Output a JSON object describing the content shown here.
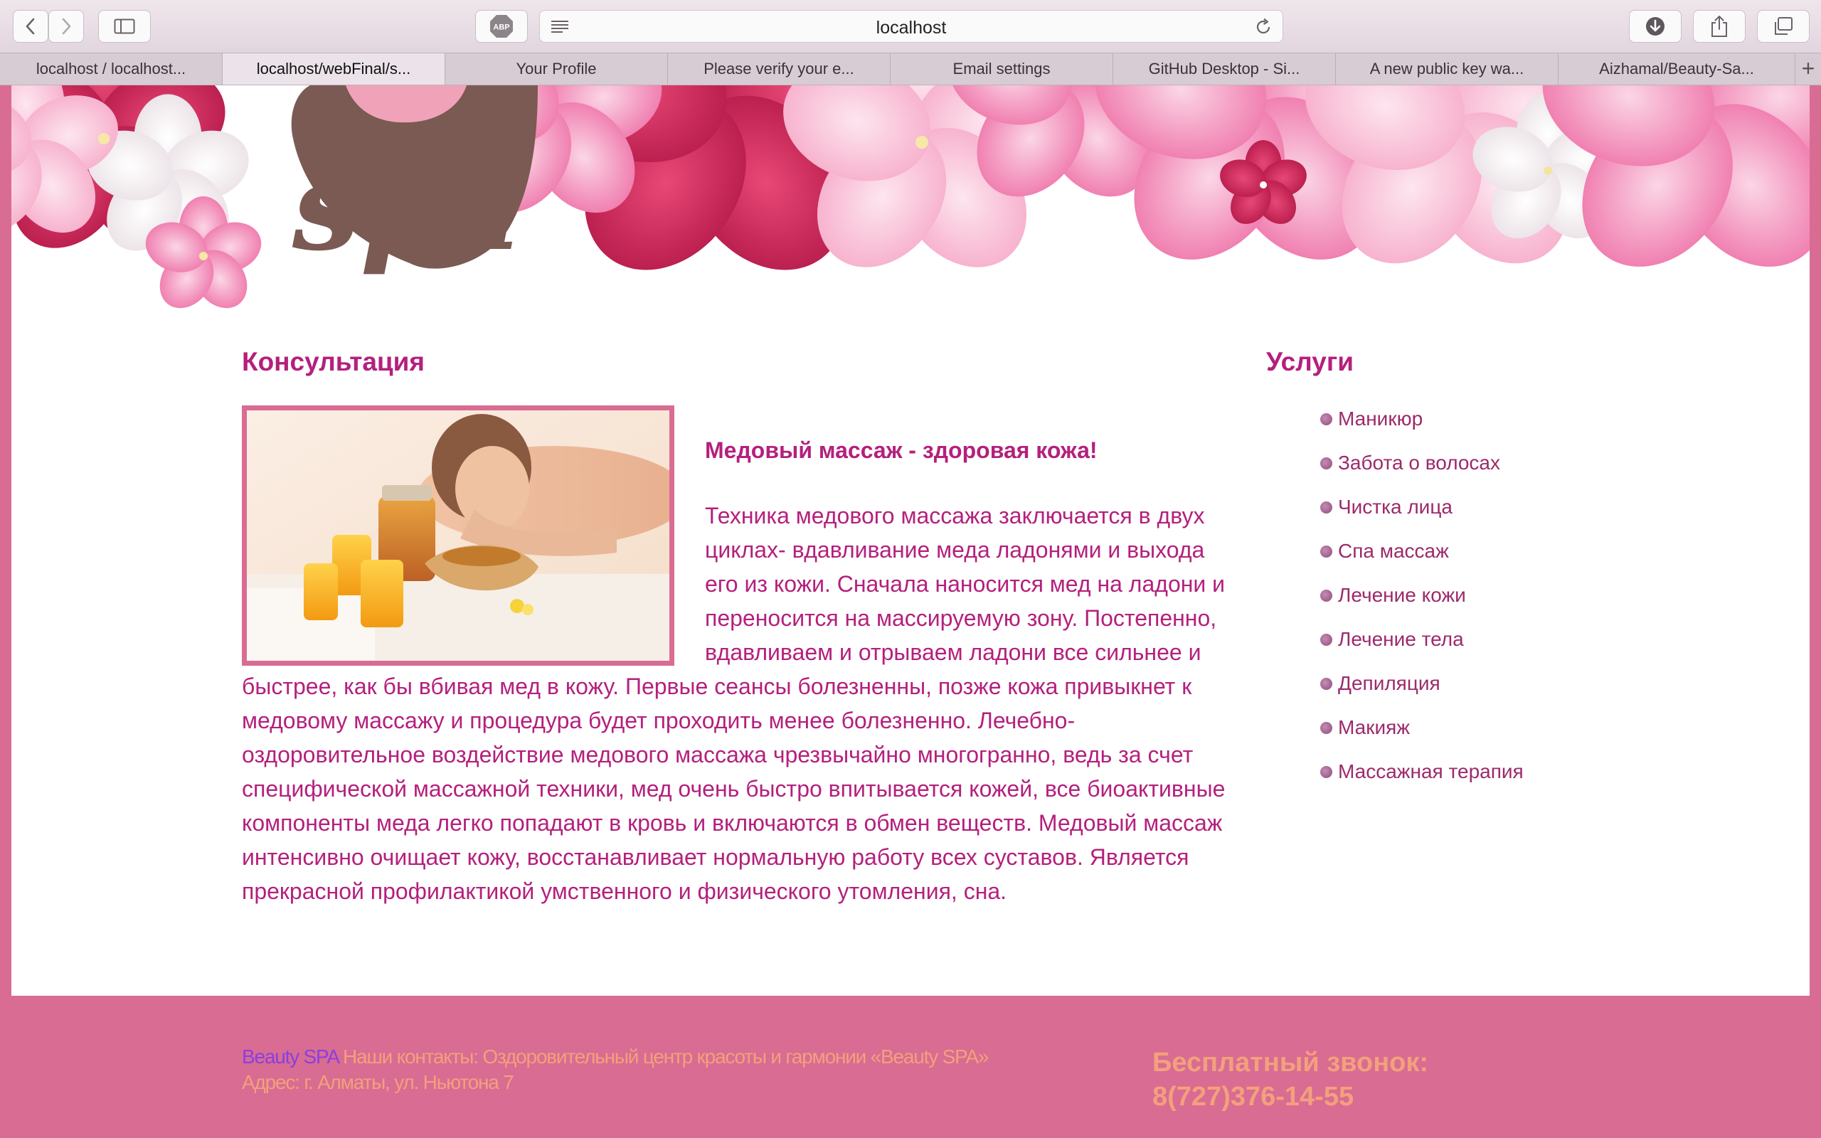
{
  "browser": {
    "url": "localhost",
    "tabs": [
      {
        "title": "localhost / localhost..."
      },
      {
        "title": "localhost/webFinal/s..."
      },
      {
        "title": "Your Profile"
      },
      {
        "title": "Please verify your e..."
      },
      {
        "title": "Email settings"
      },
      {
        "title": "GitHub Desktop - Si..."
      },
      {
        "title": "A new public key wa..."
      },
      {
        "title": "Aizhamal/Beauty-Sa..."
      }
    ],
    "active_tab": 1,
    "new_tab_label": "+",
    "adblock_label": "ABP"
  },
  "header": {
    "logo_text": "spa"
  },
  "main": {
    "title": "Консультация",
    "article_heading": "Медовый массаж - здоровая кожа!",
    "paragraph_lines": [
      "Техника медового массажа заключается в двух",
      "циклах- вдавливание меда ладонями и выхода",
      "его из кожи. Сначала наносится мед на ладони и",
      "переносится на массируемую зону. Постепенно,",
      "вдавливаем и отрываем ладони все сильнее и",
      "быстрее, как бы вбивая мед в кожу. Первые сеансы болезненны, позже кожа привыкнет к",
      "медовому массажу и процедура будет проходить менее болезненно. Лечебно-",
      "оздоровительное воздействие медового массажа чрезвычайно многогранно, ведь за счет",
      "специфической массажной техники, мед очень быстро впитывается кожей, все биоактивные",
      "компоненты меда легко попадают в кровь и включаются в обмен веществ. Медовый массаж",
      "интенсивно очищает кожу, восстанавливает нормальную работу всех суставов. Является",
      "прекрасной профилактикой умственного и физического утомления, сна."
    ]
  },
  "sidebar": {
    "title": "Услуги",
    "items": [
      "Маникюр",
      "Забота о волосах",
      "Чистка лица",
      "Спа массаж",
      "Лечение кожи",
      "Лечение тела",
      "Депиляция",
      "Макияж",
      "Массажная терапия"
    ]
  },
  "footer": {
    "brand": "Beauty SPA",
    "contacts": " Наши контакты: Оздоровительный центр красоты и гармонии «Beauty SPA»",
    "address": "Адрес: г. Алматы, ул. Ньютона 7",
    "call_label": "Бесплатный звонок:",
    "phone": "8(727)376-14-55"
  },
  "colors": {
    "accent": "#b4207d",
    "page_background": "#d96c92",
    "footer_text": "#f3a07d",
    "footer_brand": "#8a3fe0"
  }
}
